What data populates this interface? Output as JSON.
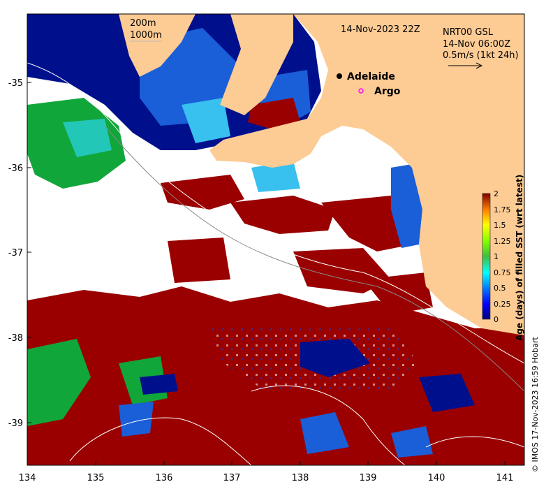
{
  "map": {
    "date_label": "14-Nov-2023 22Z",
    "contours": {
      "line1": "200m",
      "line2": "1000m"
    },
    "currents": {
      "source": "NRT00 GSL",
      "time": "14-Nov 06:00Z",
      "scale": "0.5m/s (1kt 24h)"
    },
    "places": [
      {
        "name": "Adelaide",
        "marker": "filled-dot"
      }
    ],
    "float_legend": {
      "name": "Argo",
      "marker": "magenta-open-circle"
    },
    "land_color": "#fdcb94",
    "x_ticks": [
      "134",
      "135",
      "136",
      "137",
      "138",
      "139",
      "140",
      "141"
    ],
    "y_ticks": [
      "-35",
      "-36",
      "-37",
      "-38",
      "-39"
    ],
    "extent": {
      "lon": [
        134.0,
        141.3
      ],
      "lat": [
        -39.5,
        -34.2
      ]
    }
  },
  "colorbar": {
    "label": "Age (days) of filled SST (wrt latest)",
    "ticks": [
      "2",
      "1.75",
      "1.5",
      "1.25",
      "1",
      "0.75",
      "0.5",
      "0.25",
      "0"
    ],
    "range": [
      0,
      2
    ],
    "colors": [
      "#00007f",
      "#0000ff",
      "#007fff",
      "#00ffff",
      "#7fff7f",
      "#7fff00",
      "#ffff00",
      "#ff7f00",
      "#ff0000",
      "#7f0000"
    ]
  },
  "credit": "© IMOS 17-Nov-2023 16:59 Hobart"
}
